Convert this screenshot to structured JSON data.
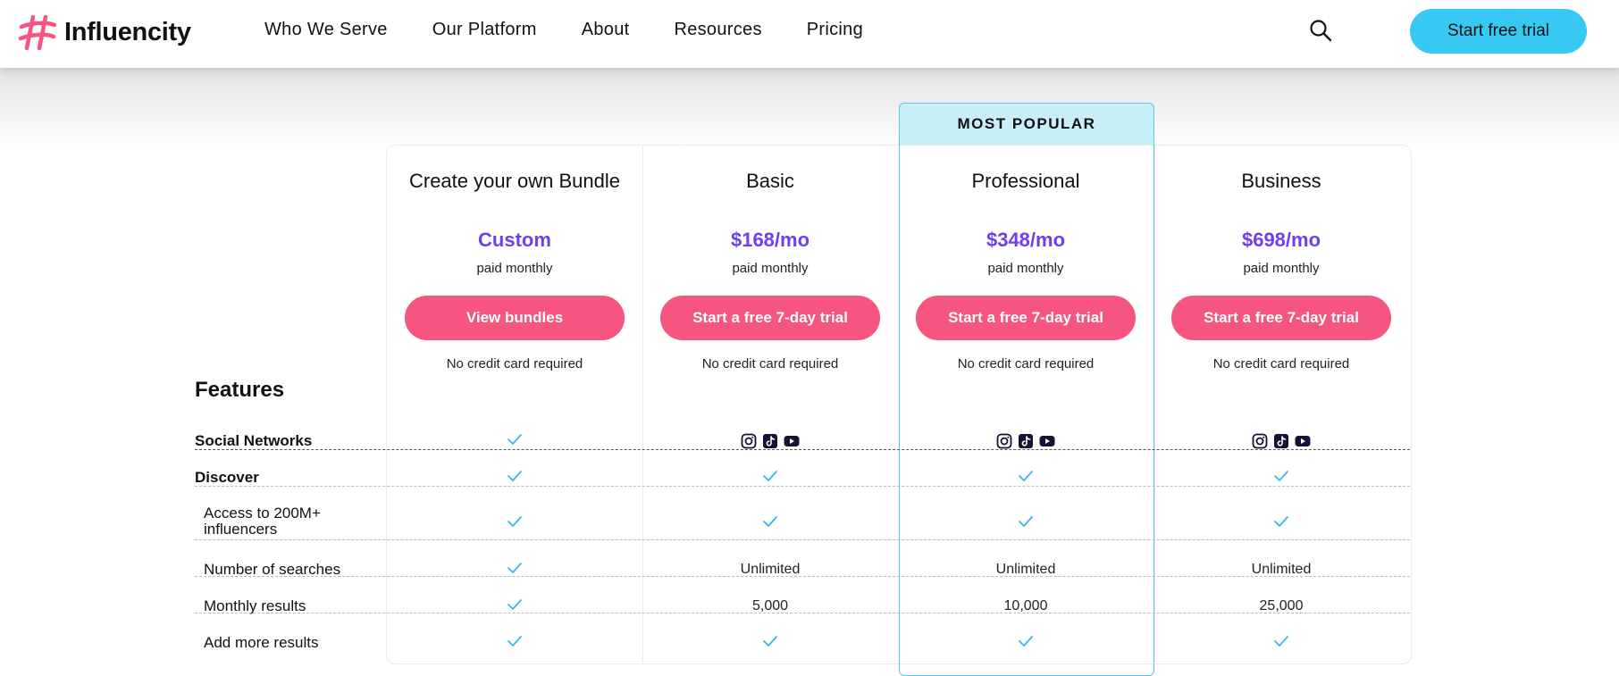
{
  "header": {
    "logo_text": "Influencity",
    "nav": [
      "Who We Serve",
      "Our Platform",
      "About",
      "Resources",
      "Pricing"
    ],
    "cta": "Start free trial"
  },
  "colors": {
    "accent": "#f5557e",
    "price": "#6f3ef0",
    "cta": "#37c8f4",
    "popular": "#c8eef8"
  },
  "popular_badge": "MOST POPULAR",
  "plans": [
    {
      "name": "Create your own Bundle",
      "price": "Custom",
      "billing": "paid monthly",
      "button": "View bundles",
      "note": "No credit card required"
    },
    {
      "name": "Basic",
      "price": "$168/mo",
      "billing": "paid monthly",
      "button": "Start a free 7-day trial",
      "note": "No credit card required"
    },
    {
      "name": "Professional",
      "price": "$348/mo",
      "billing": "paid monthly",
      "button": "Start a free 7-day trial",
      "note": "No credit card required"
    },
    {
      "name": "Business",
      "price": "$698/mo",
      "billing": "paid monthly",
      "button": "Start a free 7-day trial",
      "note": "No credit card required"
    }
  ],
  "features_title": "Features",
  "rows": [
    {
      "label": "Social Networks",
      "values": [
        "check",
        "icons",
        "icons",
        "icons"
      ]
    },
    {
      "label": "Discover",
      "values": [
        "check",
        "check",
        "check",
        "check"
      ]
    },
    {
      "label": "Access to 200M+",
      "label2": "influencers",
      "values": [
        "check",
        "check",
        "check",
        "check"
      ]
    },
    {
      "label": "Number of searches",
      "values": [
        "check",
        "Unlimited",
        "Unlimited",
        "Unlimited"
      ]
    },
    {
      "label": "Monthly results",
      "values": [
        "check",
        "5,000",
        "10,000",
        "25,000"
      ]
    },
    {
      "label": "Add more results",
      "values": [
        "check",
        "check",
        "check",
        "check"
      ]
    }
  ],
  "social_icons": [
    "instagram-icon",
    "tiktok-icon",
    "youtube-icon"
  ]
}
